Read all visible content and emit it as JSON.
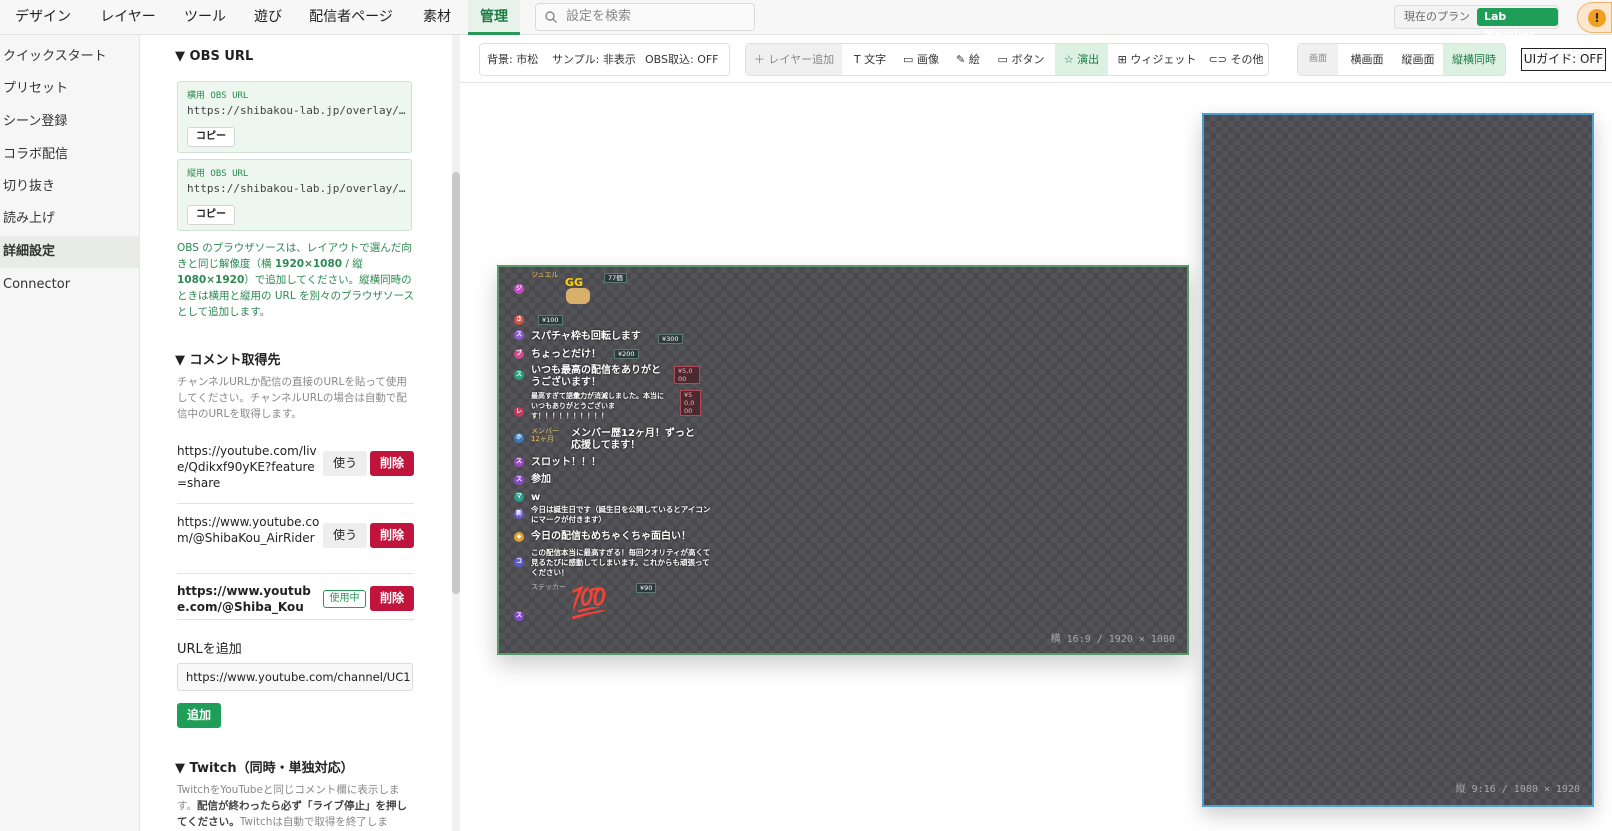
{
  "topbar": {
    "tabs": [
      "デザイン",
      "レイヤー",
      "ツール",
      "遊び",
      "配信者ページ",
      "素材",
      "管理"
    ],
    "active_tab": "管理",
    "search_placeholder": "設定を検索",
    "plan_label": "現在のプラン",
    "plan_badge": "Lab Member",
    "alert_icon": "!"
  },
  "sidebar": {
    "items": [
      "クイックスタート",
      "プリセット",
      "シーン登録",
      "コラボ配信",
      "切り抜き",
      "読み上げ",
      "詳細設定",
      "Connector"
    ],
    "active": "詳細設定"
  },
  "settings": {
    "obs_url": {
      "heading": "OBS URL",
      "horizontal_label": "横用 OBS URL",
      "horizontal_url": "https://shibakou-lab.jp/overlay/…",
      "vertical_label": "縦用 OBS URL",
      "vertical_url": "https://shibakou-lab.jp/overlay/…",
      "copy_label": "コピー",
      "desc_1": "OBS のブラウザソースは、レイアウトで選んだ向きと同じ解像度（横 ",
      "desc_res_h": "1920×1080",
      "desc_sep": " / 縦 ",
      "desc_res_v": "1080×1920",
      "desc_2": "）で追加してください。縦横同時のときは横用と縦用の URL を別々のブラウザソースとして追加します。"
    },
    "comment_source": {
      "heading": "コメント取得先",
      "desc": "チャンネルURLか配信の直接のURLを貼って使用してください。チャンネルURLの場合は自動で配信中のURLを取得します。",
      "urls": [
        {
          "text": "https://youtube.com/live/Qdikxf90yKE?feature=share",
          "use_label": "使う",
          "delete_label": "削除"
        },
        {
          "text": "https://www.youtube.com/@ShibaKou_AirRider",
          "use_label": "使う",
          "delete_label": "削除"
        },
        {
          "text": "https://www.youtube.com/@Shiba_Kou",
          "in_use_label": "使用中",
          "delete_label": "削除"
        }
      ],
      "add_heading": "URLを追加",
      "add_input_value": "https://www.youtube.com/channel/UC1",
      "add_button": "追加"
    },
    "twitch": {
      "heading": "Twitch（同時・単独対応）",
      "desc_1": "TwitchをYouTubeと同じコメント欄に表示します。",
      "desc_bold": "配信が終わったら必ず「ライブ停止」を押してください。",
      "desc_2": "Twitchは自動で取得を終了しま"
    }
  },
  "toolbar": {
    "status": {
      "background": "背景: 市松",
      "sample": "サンプル: 非表示",
      "obs": "OBS取込: OFF"
    },
    "add_layer": "レイヤー追加",
    "tools": [
      {
        "icon": "text-icon",
        "label": "文字"
      },
      {
        "icon": "image-icon",
        "label": "画像"
      },
      {
        "icon": "pen-icon",
        "label": "絵"
      },
      {
        "icon": "button-icon",
        "label": "ボタン"
      },
      {
        "icon": "star-icon",
        "label": "演出"
      },
      {
        "icon": "widget-icon",
        "label": "ウィジェット"
      },
      {
        "icon": "link-icon",
        "label": "その他"
      }
    ],
    "active_tool": "演出",
    "view": {
      "label": "画面",
      "horizontal": "横画面",
      "vertical": "縦画面",
      "both": "縦横同時",
      "active": "縦横同時"
    },
    "ui_guide": "UIガイド: OFF"
  },
  "canvas": {
    "horizontal_frame_label": "横 16:9 / 1920 × 1080",
    "vertical_frame_label": "縦 9:16 / 1080 × 1920",
    "comments": [
      {
        "avatar": "ジ",
        "avatar_color": "#c04ec0",
        "name": "ジュエル",
        "text": "GG",
        "chip": "77個"
      },
      {
        "avatar": "さ",
        "avatar_color": "#d0504a",
        "chip": "¥100",
        "text": ""
      },
      {
        "avatar": "ス",
        "avatar_color": "#8a5ad0",
        "text": "スパチャ枠も回転します",
        "chip": "¥300"
      },
      {
        "avatar": "ブ",
        "avatar_color": "#d04a8a",
        "text": "ちょっとだけ！",
        "chip": "¥200"
      },
      {
        "avatar": "ス",
        "avatar_color": "#2aa07a",
        "text": "いつも最高の配信をありがとうございます！",
        "chip": "¥5,000"
      },
      {
        "avatar": "レ",
        "avatar_color": "#c03a5a",
        "text": "最高すぎて語彙力が消滅しました。本当にいつもありがとうございます！！！！！！！！！！",
        "chip": "¥50,000"
      },
      {
        "avatar": "ホ",
        "avatar_color": "#3a7ac0",
        "name": "メンバー",
        "sub": "12ヶ月",
        "text": "メンバー歴12ヶ月！ずっと応援してます！"
      },
      {
        "avatar": "ス",
        "avatar_color": "#9a4ac0",
        "text": "スロット！！！"
      },
      {
        "avatar": "ス",
        "avatar_color": "#8a4ad0",
        "text": "参加"
      },
      {
        "avatar": "マ",
        "avatar_color": "#2a9a8a",
        "text": "w"
      },
      {
        "avatar": "新",
        "avatar_color": "#6a5ad0",
        "text": "今日は誕生日です（誕生日を公開しているとアイコンにマークが付きます）"
      },
      {
        "avatar": "◆",
        "avatar_color": "#e0a030",
        "text": "今日の配信もめちゃくちゃ面白い！"
      },
      {
        "avatar": "コ",
        "avatar_color": "#5a5ad0",
        "text": "この配信本当に最高すぎる！毎回クオリティが高くて見るたびに感動してしまいます。これからも頑張ってください！"
      },
      {
        "avatar": "ス",
        "avatar_color": "#8a4ad0",
        "name": "ステッカー",
        "chip": "¥90",
        "sticker": "💯"
      }
    ]
  }
}
